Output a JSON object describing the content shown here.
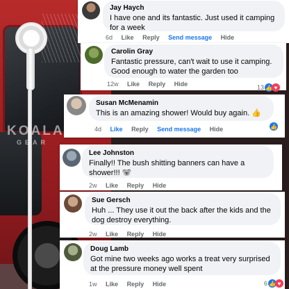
{
  "watermark": {
    "line1": "KOALA",
    "line2": "GEAR"
  },
  "comments": [
    {
      "name": "Jay Haych",
      "text": "I have one and its fantastic. Just used it camping for a week",
      "time": "6d",
      "like": "Like",
      "reply": "Reply",
      "extra": "Send message",
      "hide": "Hide"
    },
    {
      "name": "Carolin Gray",
      "text": "Fantastic pressure, can't wait to use it camping. Good enough to water the garden too",
      "time": "12w",
      "like": "Like",
      "reply": "Reply",
      "hide": "Hide",
      "reactions": "13"
    },
    {
      "name": "Susan McMenamin",
      "text": "This is an amazing shower! Would buy again. 👍",
      "time": "4d",
      "like": "Like",
      "reply": "Reply",
      "extra": "Send message",
      "hide": "Hide"
    },
    {
      "name": "Lee Johnston",
      "text": "Finally!! The bush shitting banners can have a shower!!! 🐨",
      "time": "2w",
      "like": "Like",
      "reply": "Reply",
      "hide": "Hide"
    },
    {
      "name": "Sue Gersch",
      "text": "Huh ... They use it out the back after the kids and the dog destroy everything.",
      "time": "2w",
      "like": "Like",
      "reply": "Reply",
      "hide": "Hide"
    },
    {
      "name": "Doug Lamb",
      "text": "Got mine two weeks ago works a treat very surprised at the pressure money well spent",
      "time": "1w",
      "like": "Like",
      "reply": "Reply",
      "hide": "Hide",
      "reactions": "6"
    }
  ],
  "colors": {
    "link": "#1877f2",
    "bubble": "#f0f2f5",
    "meta": "#65676b"
  }
}
